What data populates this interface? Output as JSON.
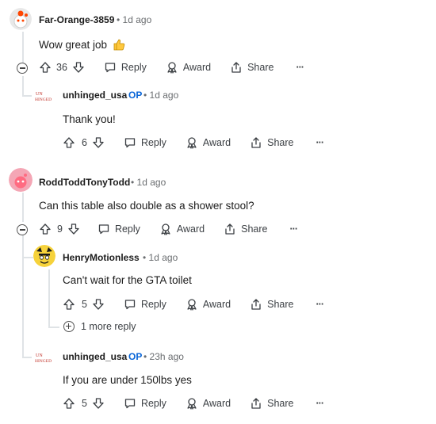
{
  "comments": [
    {
      "author": "Far-Orange-3859",
      "time": "1d ago",
      "text": "Wow great job",
      "votes": "36"
    },
    {
      "author": "unhinged_usa",
      "op": "OP",
      "time": "1d ago",
      "text": "Thank you!",
      "votes": "6"
    },
    {
      "author": "RoddToddTonyTodd",
      "time": "1d ago",
      "text": "Can this table also double as a shower stool?",
      "votes": "9"
    },
    {
      "author": "HenryMotionless",
      "time": "1d ago",
      "text": "Can't wait for the GTA toilet",
      "votes": "5"
    },
    {
      "author": "unhinged_usa",
      "op": "OP",
      "time": "23h ago",
      "text": "If you are under 150lbs yes",
      "votes": "5"
    }
  ],
  "labels": {
    "reply": "Reply",
    "award": "Award",
    "share": "Share",
    "more_replies": "1 more reply",
    "dot": "•",
    "ellipsis": "···"
  },
  "colors": {
    "op_blue": "#0a66d8",
    "thread_line": "#dfe3e6",
    "muted": "#6a6d70"
  },
  "icons": [
    "upvote-icon",
    "downvote-icon",
    "reply-icon",
    "award-icon",
    "share-icon",
    "more-icon",
    "collapse-icon",
    "expand-icon"
  ]
}
